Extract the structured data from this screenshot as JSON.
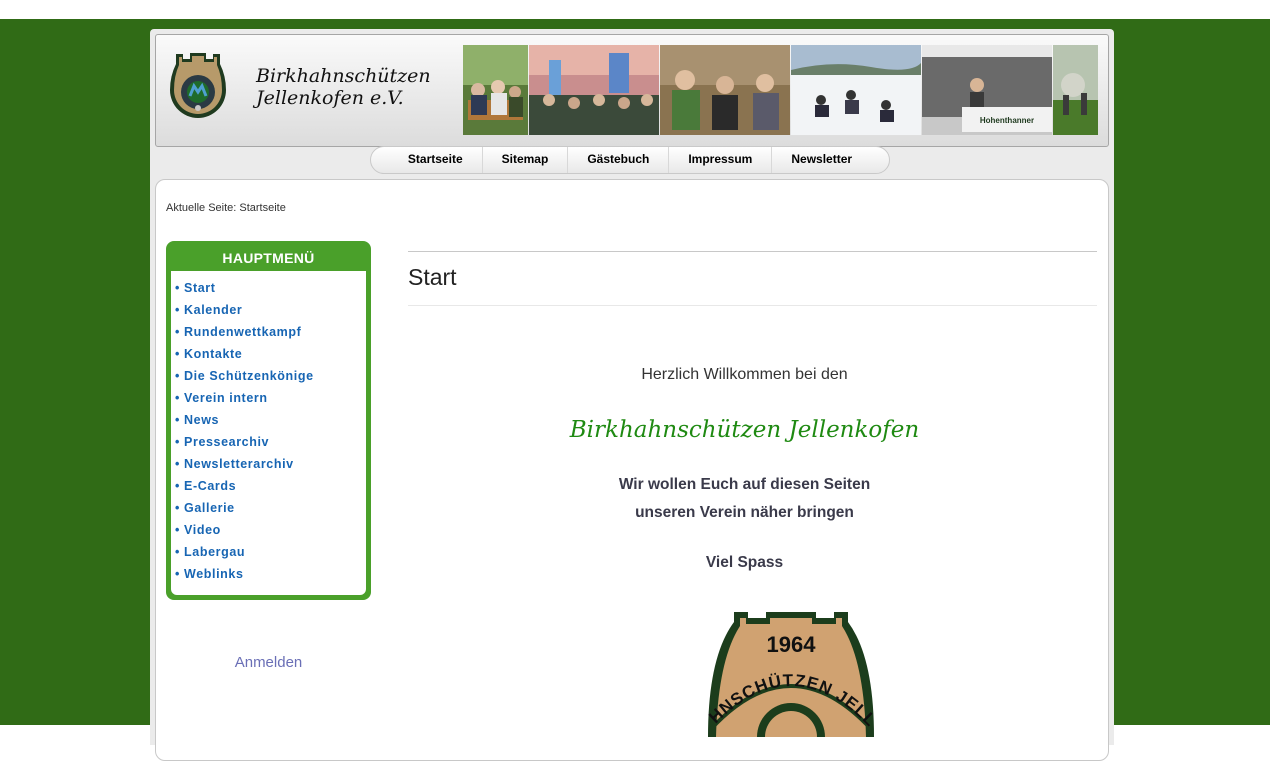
{
  "header": {
    "title_line1": "Birkhahnschützen",
    "title_line2": "Jellenkofen e.V.",
    "photo_banner_sign": "Hohenthanner"
  },
  "topnav": [
    {
      "label": "Startseite"
    },
    {
      "label": "Sitemap"
    },
    {
      "label": "Gästebuch"
    },
    {
      "label": "Impressum"
    },
    {
      "label": "Newsletter"
    }
  ],
  "breadcrumb": "Aktuelle Seite: Startseite",
  "mainmenu": {
    "title": "HAUPTMENÜ",
    "items": [
      {
        "label": "• Start"
      },
      {
        "label": "• Kalender"
      },
      {
        "label": "• Rundenwettkampf"
      },
      {
        "label": "• Kontakte"
      },
      {
        "label": "• Die Schützenkönige"
      },
      {
        "label": "• Verein intern"
      },
      {
        "label": "• News"
      },
      {
        "label": "• Pressearchiv"
      },
      {
        "label": "• Newsletterarchiv"
      },
      {
        "label": "• E-Cards"
      },
      {
        "label": "• Gallerie"
      },
      {
        "label": "• Video"
      },
      {
        "label": "• Labergau"
      },
      {
        "label": "• Weblinks"
      }
    ]
  },
  "login_link": "Anmelden",
  "article": {
    "title": "Start",
    "welcome": "Herzlich Willkommen bei den",
    "brand": "Birkhahnschützen Jellenkofen",
    "intro_line1": "Wir wollen Euch auf diesen Seiten",
    "intro_line2": "unseren Verein näher bringen",
    "closing": "Viel Spass"
  },
  "emblem": {
    "year": "1964",
    "arc_text": "HNSCHÜTZEN JELLE"
  },
  "colors": {
    "page_background": "#306b16",
    "menu_green": "#4aa02a",
    "link_blue": "#1765b3",
    "brand_green": "#1f8a12"
  }
}
